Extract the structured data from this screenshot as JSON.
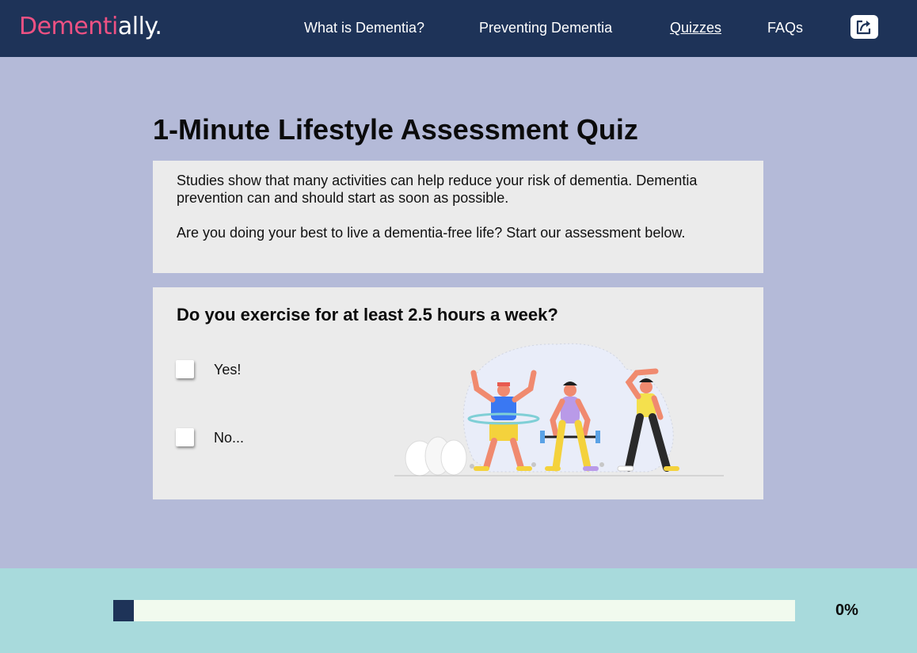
{
  "nav": {
    "logo_part1": "Dementi",
    "logo_part2": "ally.",
    "links": [
      {
        "label": "What is Dementia?"
      },
      {
        "label": "Preventing Dementia"
      },
      {
        "label": "Quizzes",
        "active": true
      },
      {
        "label": "FAQs"
      }
    ],
    "share_icon": "share-icon"
  },
  "page": {
    "title": "1-Minute Lifestyle Assessment Quiz",
    "intro_p1": "Studies show that many activities can help reduce your risk of dementia.  Dementia prevention can and should start as soon as possible.",
    "intro_p2": "Are you doing your best to live a dementia-free life? Start our assessment below."
  },
  "quiz": {
    "question": "Do you exercise for at least 2.5 hours a week?",
    "options": [
      {
        "label": "Yes!",
        "checked": false
      },
      {
        "label": "No...",
        "checked": false
      }
    ]
  },
  "progress": {
    "percent_label": "0%",
    "fill_fraction": 0.03
  },
  "colors": {
    "nav_bg": "#1e3358",
    "logo_accent": "#ee5183",
    "page_bg": "#b4bad8",
    "card_bg": "#ebebeb",
    "footer_bg": "#a8dadc",
    "track_bg": "#f1faee",
    "fill": "#1e3358"
  }
}
